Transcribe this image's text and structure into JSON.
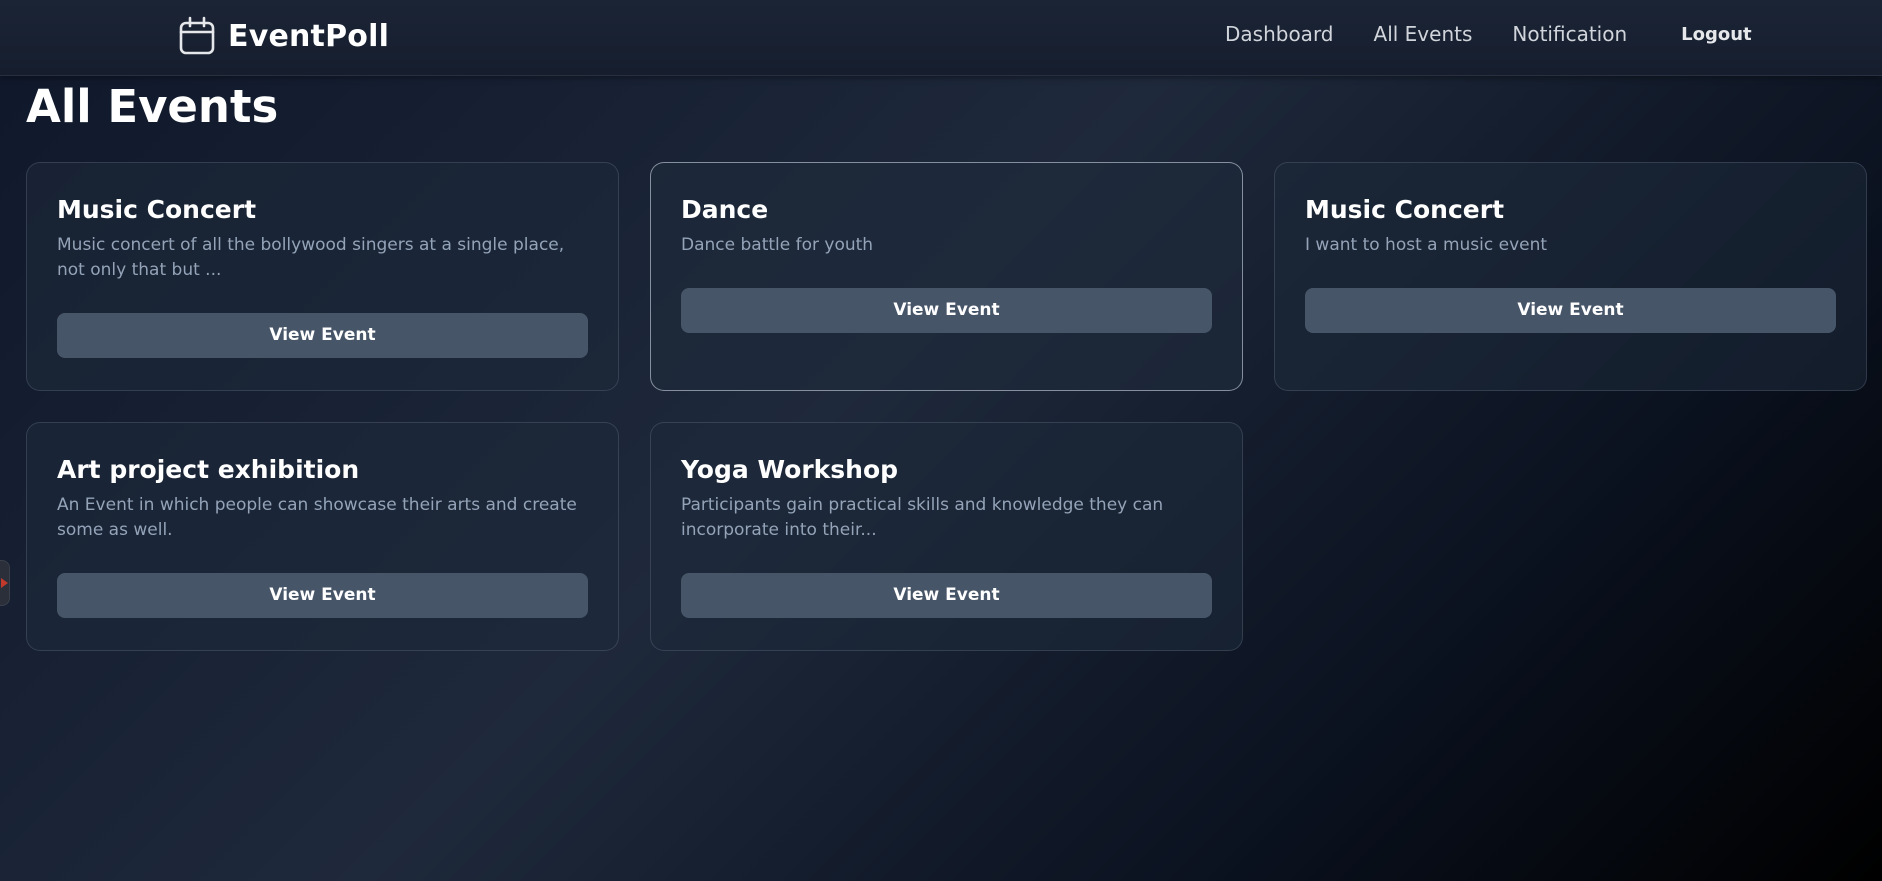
{
  "app": {
    "name": "EventPoll",
    "logo_icon": "calendar-icon"
  },
  "nav": {
    "items": [
      {
        "label": "Dashboard"
      },
      {
        "label": "All Events"
      },
      {
        "label": "Notification"
      }
    ],
    "logout_label": "Logout"
  },
  "page": {
    "title": "All Events"
  },
  "events": [
    {
      "title": "Music Concert",
      "description": "Music concert of all the bollywood singers at a single place, not only that but ...",
      "button_label": "View Event"
    },
    {
      "title": "Dance",
      "description": "Dance battle for youth",
      "button_label": "View Event"
    },
    {
      "title": "Music Concert",
      "description": "I want to host a music event",
      "button_label": "View Event"
    },
    {
      "title": "Art project exhibition",
      "description": "An Event in which people can showcase their arts and create some as well.",
      "button_label": "View Event"
    },
    {
      "title": "Yoga Workshop",
      "description": "Participants gain practical skills and knowledge they can incorporate into their...",
      "button_label": "View Event"
    }
  ],
  "side_tab": {
    "icon": "arrow-right-icon"
  },
  "colors": {
    "background": "#0f172a",
    "card_border": "#334155",
    "button": "#475569",
    "muted_text": "#94a3b8"
  }
}
